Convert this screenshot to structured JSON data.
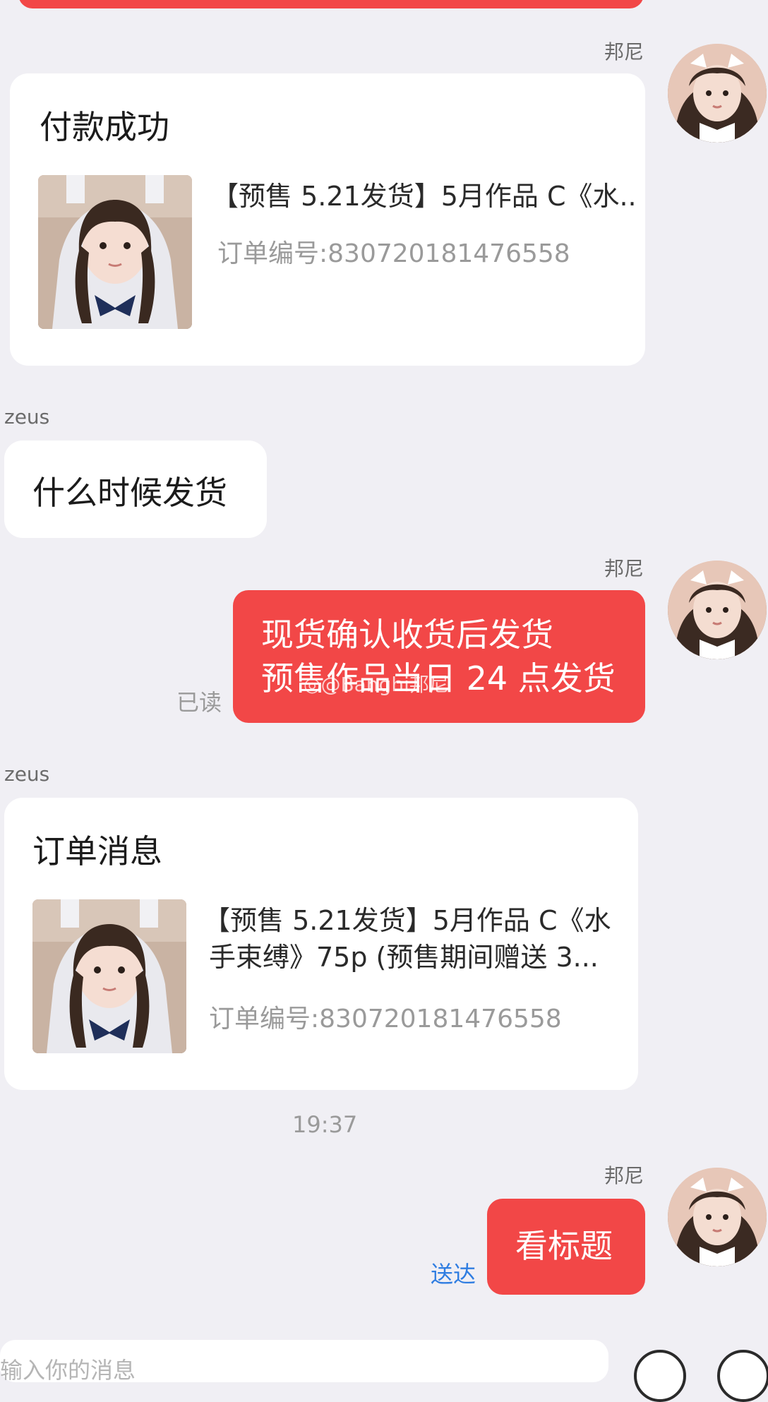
{
  "messages": [
    {
      "sender": "邦尼",
      "type": "order_card",
      "card_title": "付款成功",
      "product_title": "【预售 5.21发货】5月作品 C《水..",
      "order_number": "订单编号:830720181476558"
    },
    {
      "sender": "zeus",
      "type": "text",
      "text": "什么时候发货"
    },
    {
      "sender": "邦尼",
      "type": "text",
      "line1": "现货确认收货后发货",
      "line2": "预售作品当日 24 点发货",
      "status": "已读",
      "watermark": "@Banghi邦尼"
    },
    {
      "sender": "zeus",
      "type": "order_card",
      "card_title": "订单消息",
      "product_title_line1": "【预售 5.21发货】5月作品 C《水",
      "product_title_line2": "手束缚》75p (预售期间赠送 3...",
      "order_number": "订单编号:830720181476558"
    },
    {
      "sender": "邦尼",
      "type": "text",
      "text": "看标题",
      "status": "送达"
    }
  ],
  "timestamp": "19:37",
  "input": {
    "placeholder": "输入你的消息"
  },
  "colors": {
    "background": "#f0eff4",
    "bubble_red": "#f24747",
    "bubble_white": "#ffffff",
    "status_sent": "#2f7de1",
    "meta_gray": "#9a9a9a"
  },
  "icons": [
    "avatar-image",
    "product-thumbnail-image",
    "weibo-icon",
    "voice-icon",
    "emoji-icon"
  ]
}
